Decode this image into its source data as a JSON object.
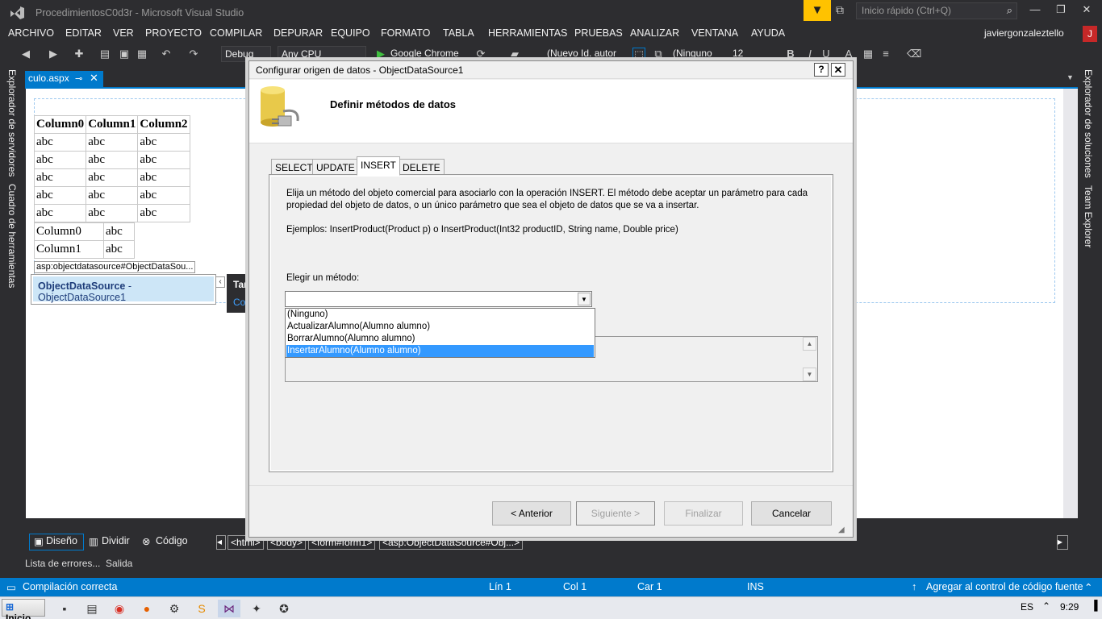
{
  "window": {
    "title": "ProcedimientosC0d3r - Microsoft Visual Studio",
    "quick_launch_placeholder": "Inicio rápido (Ctrl+Q)",
    "user_name": "javiergonzaleztello",
    "user_initial": "J"
  },
  "menu": [
    "ARCHIVO",
    "EDITAR",
    "VER",
    "PROYECTO",
    "COMPILAR",
    "DEPURAR",
    "EQUIPO",
    "FORMATO",
    "TABLA",
    "HERRAMIENTAS",
    "PRUEBAS",
    "ANALIZAR",
    "VENTANA",
    "AYUDA"
  ],
  "toolbar": {
    "config": "Debug",
    "platform": "Any CPU",
    "browser": "Google Chrome",
    "target_id": "(Nuevo Id. autor",
    "style": "(Ninguno",
    "font_size": "12",
    "bold": "B",
    "italic": "I",
    "underline": "U",
    "font_color": "A"
  },
  "left_panels": [
    "Explorador de servidores",
    "Cuadro de herramientas"
  ],
  "right_panels": [
    "Explorador de soluciones",
    "Team Explorer"
  ],
  "doc_tab": {
    "label": "culo.aspx"
  },
  "designer": {
    "grid1": {
      "headers": [
        "Column0",
        "Column1",
        "Column2"
      ],
      "rows": [
        [
          "abc",
          "abc",
          "abc"
        ],
        [
          "abc",
          "abc",
          "abc"
        ],
        [
          "abc",
          "abc",
          "abc"
        ],
        [
          "abc",
          "abc",
          "abc"
        ],
        [
          "abc",
          "abc",
          "abc"
        ]
      ]
    },
    "grid2": {
      "rows": [
        [
          "Column0",
          "abc"
        ],
        [
          "Column1",
          "abc"
        ]
      ]
    },
    "ods_tag": "asp:objectdatasource#ObjectDataSou...",
    "ods_type": "ObjectDataSource",
    "ods_name": " - ObjectDataSource1",
    "smart_tag_title": "Tar",
    "smart_tag_link": "Co"
  },
  "view_buttons": {
    "design": "Diseño",
    "split": "Dividir",
    "source": "Código"
  },
  "breadcrumbs": [
    "<html>",
    "<body>",
    "<form#form1>",
    "<asp:ObjectDataSource#Obj...>"
  ],
  "output_tabs": [
    "Lista de errores...",
    "Salida"
  ],
  "status": {
    "message": "Compilación correcta",
    "line": "Lín 1",
    "col": "Col 1",
    "char": "Car 1",
    "mode": "INS",
    "source_control": "Agregar al control de código fuente"
  },
  "taskbar": {
    "start": "Inicio",
    "lang": "ES",
    "time": "9:29"
  },
  "dialog": {
    "title": "Configurar origen de datos - ObjectDataSource1",
    "heading": "Definir métodos de datos",
    "tabs": [
      "SELECT",
      "UPDATE",
      "INSERT",
      "DELETE"
    ],
    "active_tab": "INSERT",
    "description": "Elija un método del objeto comercial para asociarlo con la operación INSERT. El método debe aceptar un parámetro para cada propiedad del objeto de datos, o un único parámetro que sea el objeto de datos que se va a insertar.",
    "examples": "Ejemplos: InsertProduct(Product p) o InsertProduct(Int32 productID, String name, Double price)",
    "choose_label": "Elegir un método:",
    "method_value": "",
    "method_options": [
      "(Ninguno)",
      "ActualizarAlumno(Alumno alumno)",
      "BorrarAlumno(Alumno alumno)",
      "InsertarAlumno(Alumno alumno)"
    ],
    "highlighted_option": "InsertarAlumno(Alumno alumno)",
    "buttons": {
      "back": "< Anterior",
      "next": "Siguiente >",
      "finish": "Finalizar",
      "cancel": "Cancelar"
    },
    "help": "?",
    "close": "✕"
  }
}
